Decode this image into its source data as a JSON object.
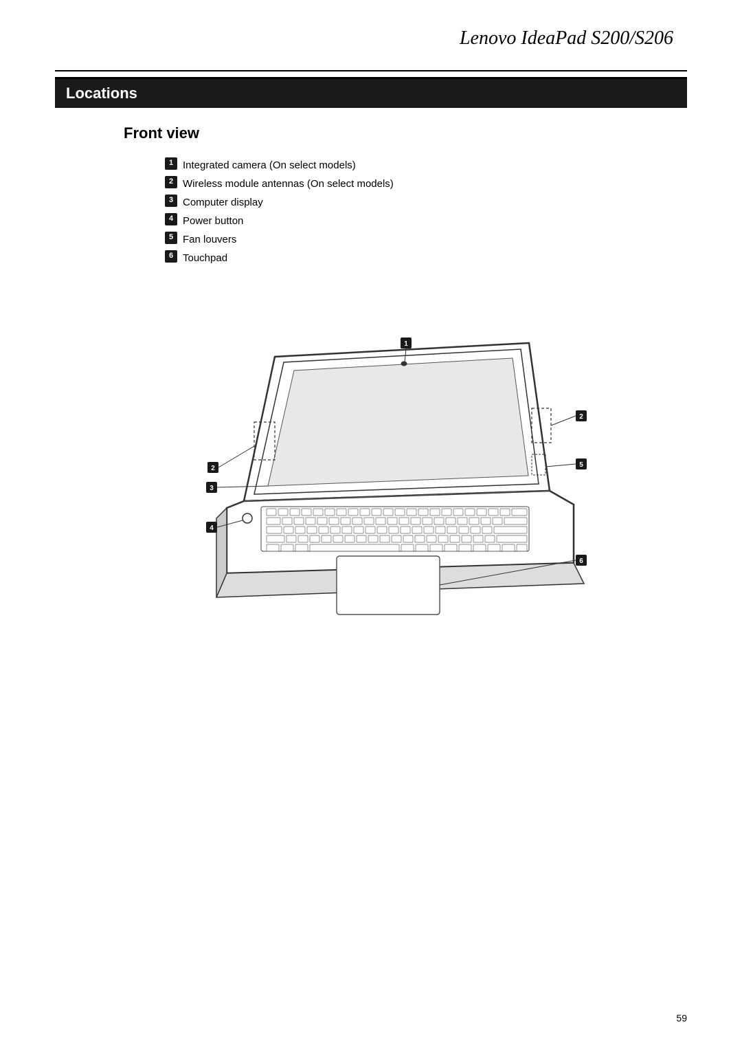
{
  "header": {
    "title": "Lenovo IdeaPad S200/S206"
  },
  "section": {
    "title": "Locations",
    "subsection": "Front view",
    "parts": [
      {
        "id": "1",
        "label": "Integrated camera (On select models)"
      },
      {
        "id": "2",
        "label": "Wireless module antennas (On select models)"
      },
      {
        "id": "3",
        "label": "Computer display"
      },
      {
        "id": "4",
        "label": "Power button"
      },
      {
        "id": "5",
        "label": "Fan louvers"
      },
      {
        "id": "6",
        "label": "Touchpad"
      }
    ]
  },
  "page_number": "59"
}
